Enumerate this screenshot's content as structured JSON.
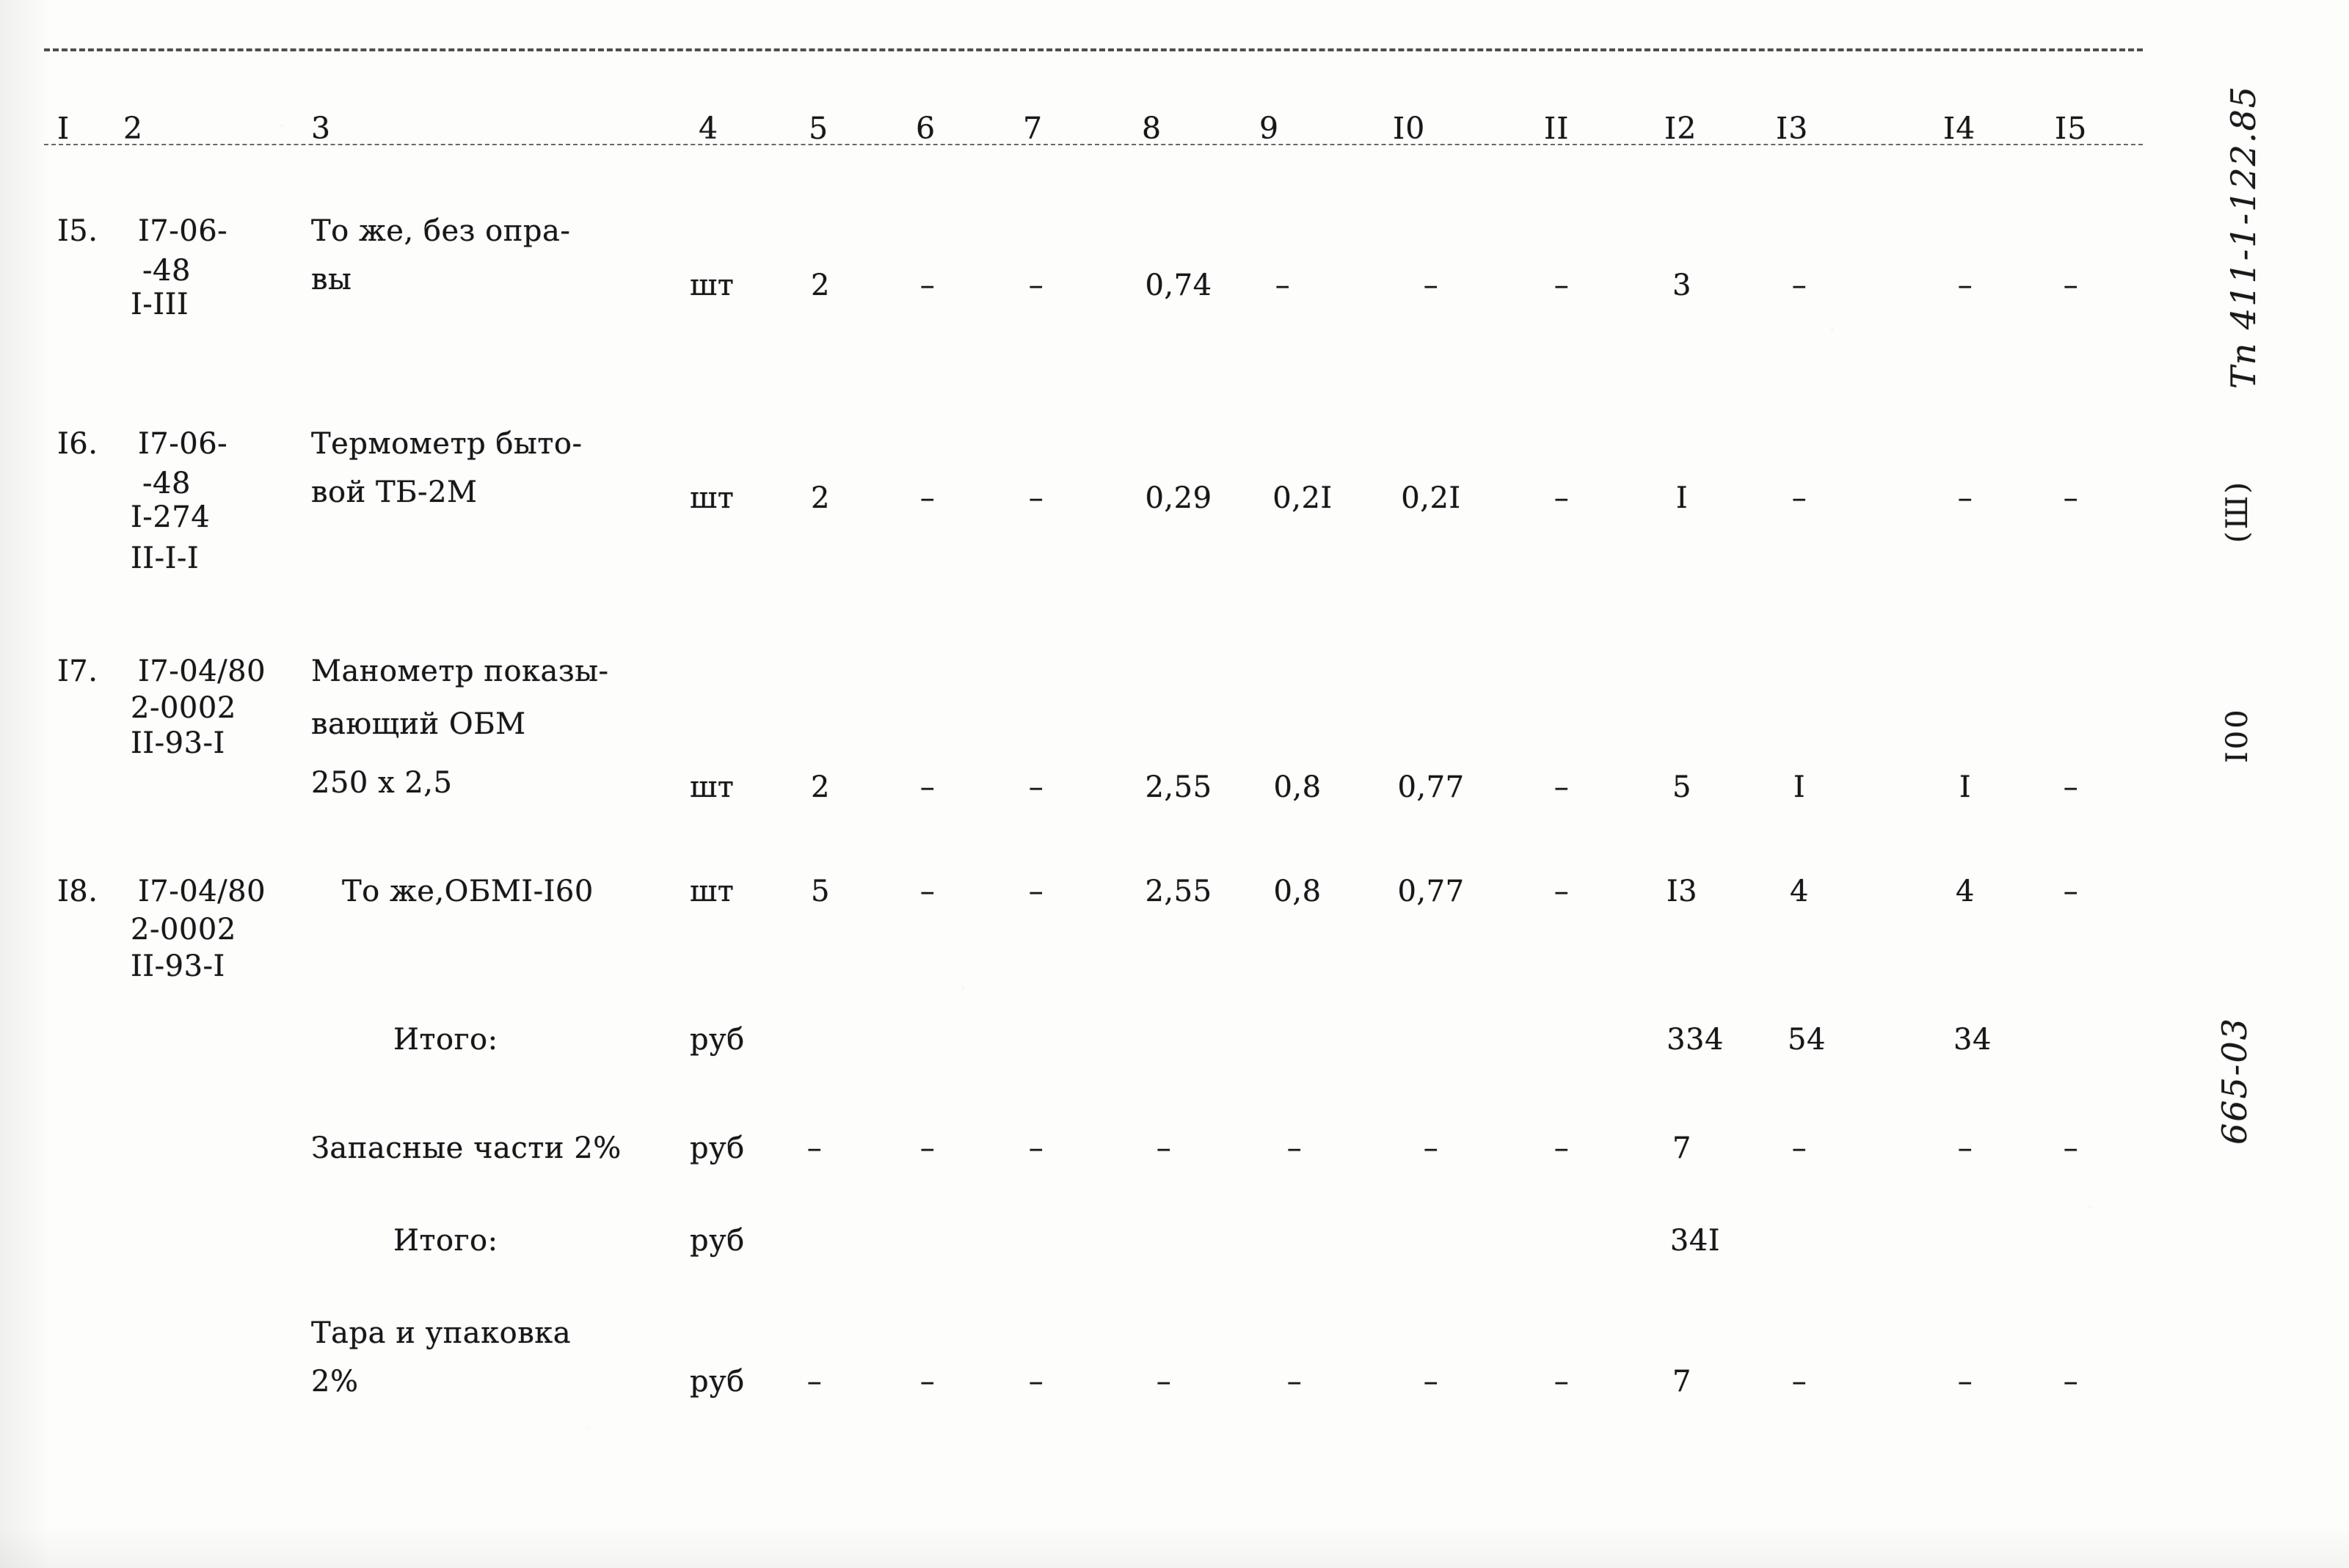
{
  "document": {
    "type": "typewritten-cost-table",
    "page_number": "I00",
    "margin_annotations": {
      "spec_code": "Тп 411-1-122.85",
      "spec_suffix": "(Ш)",
      "archive_code": "665-03"
    }
  },
  "table": {
    "column_headers": [
      "I",
      "2",
      "3",
      "4",
      "5",
      "6",
      "7",
      "8",
      "9",
      "I0",
      "II",
      "I2",
      "I3",
      "I4",
      "I5"
    ],
    "rows": [
      {
        "kind": "item",
        "index": "I5.",
        "code_lines": [
          "I7-06-",
          "-48",
          "I-III"
        ],
        "name_lines": [
          "То же, без опра-",
          "вы"
        ],
        "unit": "шт",
        "values": [
          "2",
          "–",
          "–",
          "0,74",
          "–",
          "–",
          "–",
          "3",
          "–",
          "–",
          "–"
        ]
      },
      {
        "kind": "item",
        "index": "I6.",
        "code_lines": [
          "I7-06-",
          "-48",
          "I-274",
          "II-I-I"
        ],
        "name_lines": [
          "Термометр быто-",
          "вой ТБ-2М"
        ],
        "unit": "шт",
        "values": [
          "2",
          "–",
          "–",
          "0,29",
          "0,2I",
          "0,2I",
          "–",
          "I",
          "–",
          "–",
          "–"
        ]
      },
      {
        "kind": "item",
        "index": "I7.",
        "code_lines": [
          "I7-04/80",
          "2-0002",
          "II-93-I"
        ],
        "name_lines": [
          "Манометр показы-",
          "вающий ОБМ",
          "250 х 2,5"
        ],
        "unit": "шт",
        "values": [
          "2",
          "–",
          "–",
          "2,55",
          "0,8",
          "0,77",
          "–",
          "5",
          "I",
          "I",
          "–"
        ]
      },
      {
        "kind": "item",
        "index": "I8.",
        "code_lines": [
          "I7-04/80",
          "2-0002",
          "II-93-I"
        ],
        "name_lines": [
          "То же,ОБМI-I60"
        ],
        "unit": "шт",
        "values": [
          "5",
          "–",
          "–",
          "2,55",
          "0,8",
          "0,77",
          "–",
          "I3",
          "4",
          "4",
          "–"
        ]
      },
      {
        "kind": "total",
        "label": "Итого:",
        "unit": "руб",
        "values": [
          "",
          "",
          "",
          "",
          "",
          "",
          "",
          "334",
          "54",
          "34",
          ""
        ]
      },
      {
        "kind": "total",
        "label": "Запасные части 2%",
        "unit": "руб",
        "values": [
          "–",
          "–",
          "–",
          "–",
          "–",
          "–",
          "–",
          "7",
          "–",
          "–",
          "–"
        ]
      },
      {
        "kind": "total",
        "label": "Итого:",
        "unit": "руб",
        "values": [
          "",
          "",
          "",
          "",
          "",
          "",
          "",
          "34I",
          "",
          "",
          ""
        ]
      },
      {
        "kind": "total",
        "label_lines": [
          "Тара и упаковка",
          "2%"
        ],
        "unit": "руб",
        "values": [
          "–",
          "–",
          "–",
          "–",
          "–",
          "–",
          "–",
          "7",
          "–",
          "–",
          "–"
        ]
      }
    ]
  }
}
